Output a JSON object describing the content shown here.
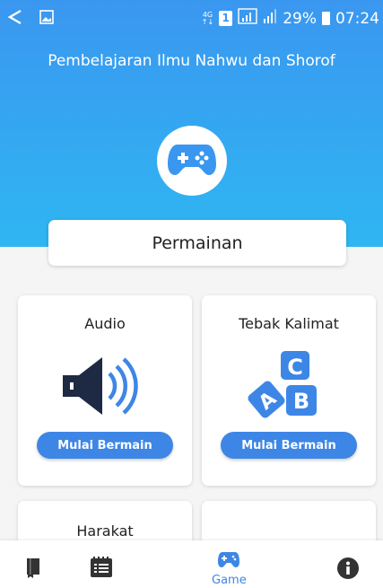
{
  "status_bar": {
    "network": "4G",
    "sim": "1",
    "battery": "29%",
    "time": "07:24"
  },
  "app": {
    "title": "Pembelajaran Ilmu Nahwu dan Shorof"
  },
  "section": {
    "title": "Permainan"
  },
  "games": [
    {
      "title": "Audio",
      "button": "Mulai Bermain",
      "icon": "speaker-icon"
    },
    {
      "title": "Tebak Kalimat",
      "button": "Mulai Bermain",
      "icon": "abc-blocks-icon"
    },
    {
      "title": "Harakat",
      "button": "",
      "icon": ""
    },
    {
      "title": "",
      "button": "",
      "icon": ""
    }
  ],
  "bottom_nav": {
    "active_label": "Game",
    "items": [
      "book-icon",
      "list-icon",
      "gamepad-icon",
      "info-icon"
    ]
  },
  "colors": {
    "header_top": "#3a97f0",
    "header_bottom": "#2fb6f2",
    "accent": "#3d86e6"
  }
}
